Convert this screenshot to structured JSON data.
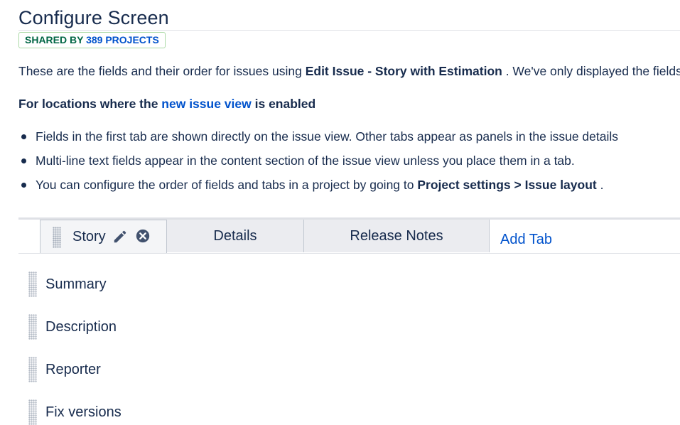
{
  "header": {
    "title": "Configure Screen",
    "shared_prefix": "SHARED BY",
    "shared_count_link": "389 PROJECTS"
  },
  "intro": {
    "before": "These are the fields and their order for issues using ",
    "screen_name": "Edit Issue - Story with Estimation",
    "after": " . We've only displayed the fields that are relevant for this screen."
  },
  "new_view": {
    "prefix": "For locations where the ",
    "link": "new issue view",
    "suffix": " is enabled"
  },
  "bullets": {
    "b1": "Fields in the first tab are shown directly on the issue view. Other tabs appear as panels in the issue details",
    "b2": "Multi-line text fields appear in the content section of the issue view unless you place them in a tab.",
    "b3_before": "You can configure the order of fields and tabs in a project by going to ",
    "b3_bold": "Project settings > Issue layout",
    "b3_after": " ."
  },
  "tabs": [
    {
      "label": "Story"
    },
    {
      "label": "Details"
    },
    {
      "label": "Release Notes"
    }
  ],
  "add_tab_label": "Add Tab",
  "fields": [
    {
      "label": "Summary"
    },
    {
      "label": "Description"
    },
    {
      "label": "Reporter"
    },
    {
      "label": "Fix versions"
    }
  ],
  "icons": {
    "grip": "drag-handle-icon",
    "edit": "pencil-icon",
    "remove": "close-circle-icon"
  },
  "colors": {
    "text": "#172b4d",
    "link": "#0052cc",
    "success": "#006644",
    "tab_bg": "#ebecf0"
  }
}
